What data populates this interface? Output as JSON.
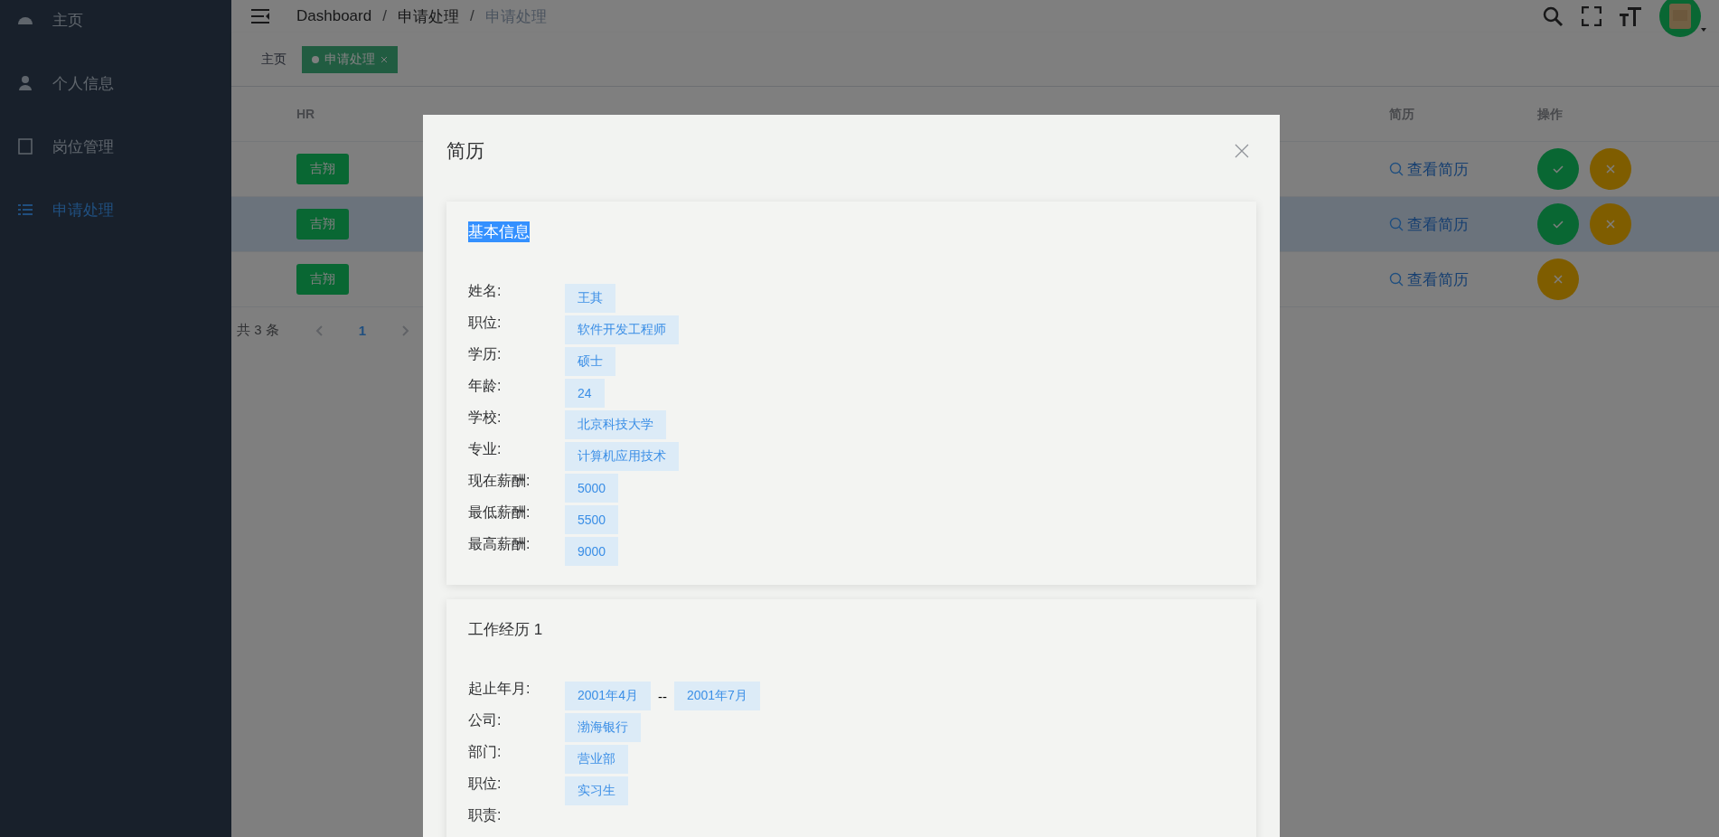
{
  "sidebar": {
    "items": [
      {
        "label": "主页",
        "kind": "dashboard",
        "selected": false
      },
      {
        "label": "个人信息",
        "kind": "user",
        "selected": false
      },
      {
        "label": "岗位管理",
        "kind": "doc",
        "selected": false
      },
      {
        "label": "申请处理",
        "kind": "list",
        "selected": true
      }
    ]
  },
  "header": {
    "breadcrumb": [
      "Dashboard",
      "申请处理",
      "申请处理"
    ],
    "separator": "/"
  },
  "tags": [
    {
      "label": "主页",
      "selected": false
    },
    {
      "label": "申请处理",
      "selected": true
    }
  ],
  "table": {
    "columns": [
      "HR",
      "简历",
      "操作"
    ],
    "rows": [
      {
        "hr": "吉翔",
        "resume": "查看简历",
        "selected": false,
        "actions": [
          {
            "kind": "approve"
          },
          {
            "kind": "reject"
          }
        ]
      },
      {
        "hr": "吉翔",
        "resume": "查看简历",
        "selected": true,
        "actions": [
          {
            "kind": "approve"
          },
          {
            "kind": "reject"
          }
        ]
      },
      {
        "hr": "吉翔",
        "resume": "查看简历",
        "selected": false,
        "actions": [
          {
            "kind": "reject"
          }
        ]
      }
    ]
  },
  "pagination": {
    "total": "共 3 条",
    "pages": [
      {
        "label": "1",
        "selected": true
      }
    ]
  },
  "modal": {
    "title": "简历",
    "sections": [
      {
        "title": "基本信息",
        "highlighted": true,
        "fields": [
          {
            "label": "姓名:",
            "values": [
              "王其"
            ]
          },
          {
            "label": "职位:",
            "values": [
              "软件开发工程师"
            ]
          },
          {
            "label": "学历:",
            "values": [
              "硕士"
            ]
          },
          {
            "label": "年龄:",
            "values": [
              "24"
            ]
          },
          {
            "label": "学校:",
            "values": [
              "北京科技大学"
            ]
          },
          {
            "label": "专业:",
            "values": [
              "计算机应用技术"
            ]
          },
          {
            "label": "现在薪酬:",
            "values": [
              "5000"
            ]
          },
          {
            "label": "最低薪酬:",
            "values": [
              "5500"
            ]
          },
          {
            "label": "最高薪酬:",
            "values": [
              "9000"
            ]
          }
        ]
      },
      {
        "title": "工作经历 1",
        "highlighted": false,
        "fields": [
          {
            "label": "起止年月:",
            "values": [
              "2001年4月",
              "2001年7月"
            ],
            "separator": "--"
          },
          {
            "label": "公司:",
            "values": [
              "渤海银行"
            ]
          },
          {
            "label": "部门:",
            "values": [
              "营业部"
            ]
          },
          {
            "label": "职位:",
            "values": [
              "实习生"
            ]
          },
          {
            "label": "职责:"
          }
        ]
      }
    ]
  }
}
